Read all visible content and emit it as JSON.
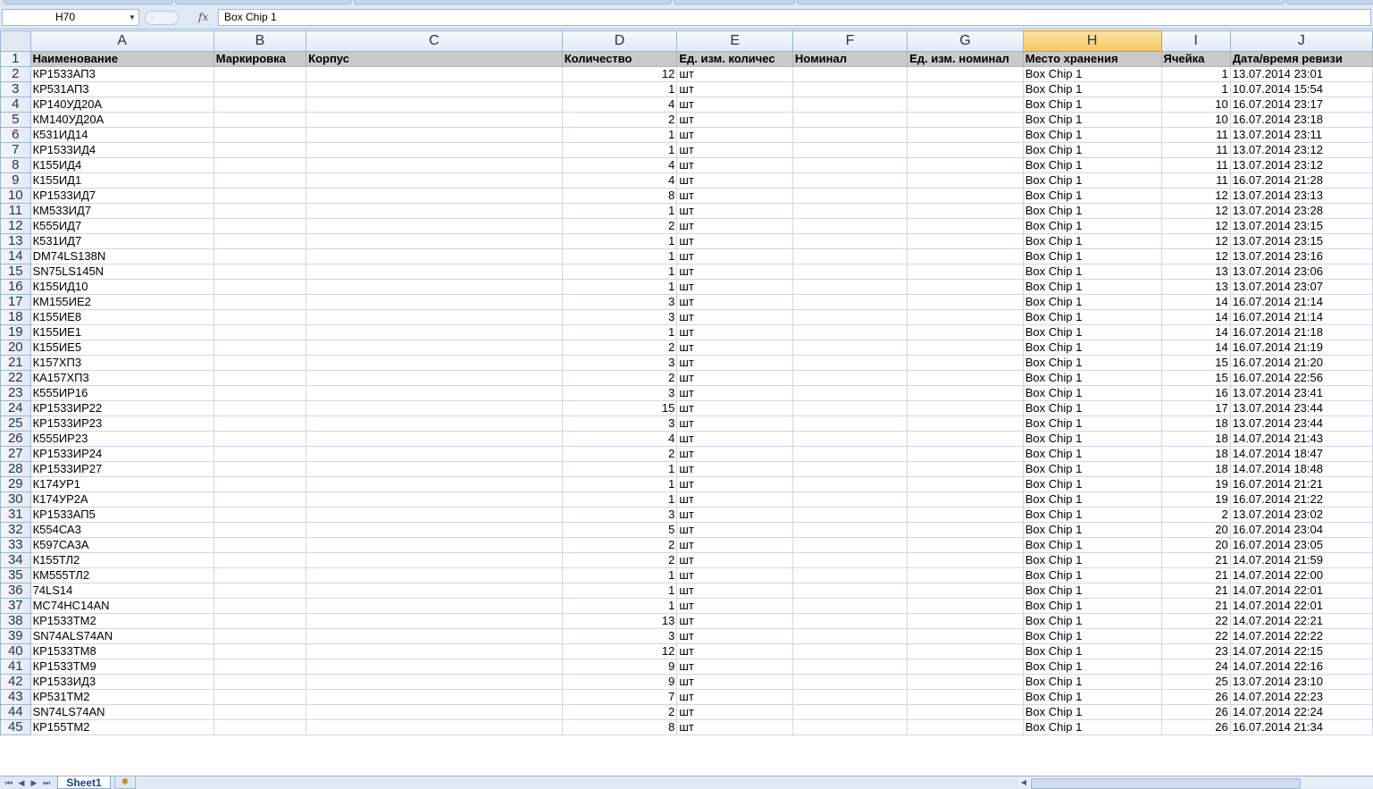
{
  "formula_bar": {
    "name_box": "H70",
    "function_icon": "fx-icon",
    "content": "Box Chip 1"
  },
  "grid": {
    "columns": [
      "A",
      "B",
      "C",
      "D",
      "E",
      "F",
      "G",
      "H",
      "I",
      "J"
    ],
    "selected_column": "H",
    "headers": [
      "Наименование",
      "Маркировка",
      "Корпус",
      "Количество",
      "Ед. изм. количес",
      "Номинал",
      "Ед. изм. номинал",
      "Место хранения",
      "Ячейка",
      "Дата/время ревизи"
    ],
    "rows": [
      [
        "КР1533АП3",
        "",
        "",
        "12",
        "шт",
        "",
        "",
        "Box Chip 1",
        "1",
        "13.07.2014 23:01"
      ],
      [
        "КР531АП3",
        "",
        "",
        "1",
        "шт",
        "",
        "",
        "Box Chip 1",
        "1",
        "10.07.2014 15:54"
      ],
      [
        "КР140УД20А",
        "",
        "",
        "4",
        "шт",
        "",
        "",
        "Box Chip 1",
        "10",
        "16.07.2014 23:17"
      ],
      [
        "КМ140УД20А",
        "",
        "",
        "2",
        "шт",
        "",
        "",
        "Box Chip 1",
        "10",
        "16.07.2014 23:18"
      ],
      [
        "К531ИД14",
        "",
        "",
        "1",
        "шт",
        "",
        "",
        "Box Chip 1",
        "11",
        "13.07.2014 23:11"
      ],
      [
        "КР1533ИД4",
        "",
        "",
        "1",
        "шт",
        "",
        "",
        "Box Chip 1",
        "11",
        "13.07.2014 23:12"
      ],
      [
        "К155ИД4",
        "",
        "",
        "4",
        "шт",
        "",
        "",
        "Box Chip 1",
        "11",
        "13.07.2014 23:12"
      ],
      [
        "К155ИД1",
        "",
        "",
        "4",
        "шт",
        "",
        "",
        "Box Chip 1",
        "11",
        "16.07.2014 21:28"
      ],
      [
        "КР1533ИД7",
        "",
        "",
        "8",
        "шт",
        "",
        "",
        "Box Chip 1",
        "12",
        "13.07.2014 23:13"
      ],
      [
        "КМ533ИД7",
        "",
        "",
        "1",
        "шт",
        "",
        "",
        "Box Chip 1",
        "12",
        "13.07.2014 23:28"
      ],
      [
        "К555ИД7",
        "",
        "",
        "2",
        "шт",
        "",
        "",
        "Box Chip 1",
        "12",
        "13.07.2014 23:15"
      ],
      [
        "К531ИД7",
        "",
        "",
        "1",
        "шт",
        "",
        "",
        "Box Chip 1",
        "12",
        "13.07.2014 23:15"
      ],
      [
        "DM74LS138N",
        "",
        "",
        "1",
        "шт",
        "",
        "",
        "Box Chip 1",
        "12",
        "13.07.2014 23:16"
      ],
      [
        "SN75LS145N",
        "",
        "",
        "1",
        "шт",
        "",
        "",
        "Box Chip 1",
        "13",
        "13.07.2014 23:06"
      ],
      [
        "К155ИД10",
        "",
        "",
        "1",
        "шт",
        "",
        "",
        "Box Chip 1",
        "13",
        "13.07.2014 23:07"
      ],
      [
        "КМ155ИЕ2",
        "",
        "",
        "3",
        "шт",
        "",
        "",
        "Box Chip 1",
        "14",
        "16.07.2014 21:14"
      ],
      [
        "К155ИЕ8",
        "",
        "",
        "3",
        "шт",
        "",
        "",
        "Box Chip 1",
        "14",
        "16.07.2014 21:14"
      ],
      [
        "К155ИЕ1",
        "",
        "",
        "1",
        "шт",
        "",
        "",
        "Box Chip 1",
        "14",
        "16.07.2014 21:18"
      ],
      [
        "К155ИЕ5",
        "",
        "",
        "2",
        "шт",
        "",
        "",
        "Box Chip 1",
        "14",
        "16.07.2014 21:19"
      ],
      [
        "К157ХП3",
        "",
        "",
        "3",
        "шт",
        "",
        "",
        "Box Chip 1",
        "15",
        "16.07.2014 21:20"
      ],
      [
        "КА157ХП3",
        "",
        "",
        "2",
        "шт",
        "",
        "",
        "Box Chip 1",
        "15",
        "16.07.2014 22:56"
      ],
      [
        "К555ИР16",
        "",
        "",
        "3",
        "шт",
        "",
        "",
        "Box Chip 1",
        "16",
        "13.07.2014 23:41"
      ],
      [
        "КР1533ИР22",
        "",
        "",
        "15",
        "шт",
        "",
        "",
        "Box Chip 1",
        "17",
        "13.07.2014 23:44"
      ],
      [
        "КР1533ИР23",
        "",
        "",
        "3",
        "шт",
        "",
        "",
        "Box Chip 1",
        "18",
        "13.07.2014 23:44"
      ],
      [
        "К555ИР23",
        "",
        "",
        "4",
        "шт",
        "",
        "",
        "Box Chip 1",
        "18",
        "14.07.2014 21:43"
      ],
      [
        "КР1533ИР24",
        "",
        "",
        "2",
        "шт",
        "",
        "",
        "Box Chip 1",
        "18",
        "14.07.2014 18:47"
      ],
      [
        "КР1533ИР27",
        "",
        "",
        "1",
        "шт",
        "",
        "",
        "Box Chip 1",
        "18",
        "14.07.2014 18:48"
      ],
      [
        "К174УР1",
        "",
        "",
        "1",
        "шт",
        "",
        "",
        "Box Chip 1",
        "19",
        "16.07.2014 21:21"
      ],
      [
        "К174УР2А",
        "",
        "",
        "1",
        "шт",
        "",
        "",
        "Box Chip 1",
        "19",
        "16.07.2014 21:22"
      ],
      [
        "КР1533АП5",
        "",
        "",
        "3",
        "шт",
        "",
        "",
        "Box Chip 1",
        "2",
        "13.07.2014 23:02"
      ],
      [
        "К554СА3",
        "",
        "",
        "5",
        "шт",
        "",
        "",
        "Box Chip 1",
        "20",
        "16.07.2014 23:04"
      ],
      [
        "К597СА3А",
        "",
        "",
        "2",
        "шт",
        "",
        "",
        "Box Chip 1",
        "20",
        "16.07.2014 23:05"
      ],
      [
        "К155ТЛ2",
        "",
        "",
        "2",
        "шт",
        "",
        "",
        "Box Chip 1",
        "21",
        "14.07.2014 21:59"
      ],
      [
        "КМ555ТЛ2",
        "",
        "",
        "1",
        "шт",
        "",
        "",
        "Box Chip 1",
        "21",
        "14.07.2014 22:00"
      ],
      [
        "74LS14",
        "",
        "",
        "1",
        "шт",
        "",
        "",
        "Box Chip 1",
        "21",
        "14.07.2014 22:01"
      ],
      [
        "MC74HC14AN",
        "",
        "",
        "1",
        "шт",
        "",
        "",
        "Box Chip 1",
        "21",
        "14.07.2014 22:01"
      ],
      [
        "КР1533ТМ2",
        "",
        "",
        "13",
        "шт",
        "",
        "",
        "Box Chip 1",
        "22",
        "14.07.2014 22:21"
      ],
      [
        "SN74ALS74AN",
        "",
        "",
        "3",
        "шт",
        "",
        "",
        "Box Chip 1",
        "22",
        "14.07.2014 22:22"
      ],
      [
        "КР1533ТМ8",
        "",
        "",
        "12",
        "шт",
        "",
        "",
        "Box Chip 1",
        "23",
        "14.07.2014 22:15"
      ],
      [
        "КР1533ТМ9",
        "",
        "",
        "9",
        "шт",
        "",
        "",
        "Box Chip 1",
        "24",
        "14.07.2014 22:16"
      ],
      [
        "КР1533ИД3",
        "",
        "",
        "9",
        "шт",
        "",
        "",
        "Box Chip 1",
        "25",
        "13.07.2014 23:10"
      ],
      [
        "КР531ТМ2",
        "",
        "",
        "7",
        "шт",
        "",
        "",
        "Box Chip 1",
        "26",
        "14.07.2014 22:23"
      ],
      [
        "SN74LS74AN",
        "",
        "",
        "2",
        "шт",
        "",
        "",
        "Box Chip 1",
        "26",
        "14.07.2014 22:24"
      ],
      [
        "КР155ТМ2",
        "",
        "",
        "8",
        "шт",
        "",
        "",
        "Box Chip 1",
        "26",
        "16.07.2014 21:34"
      ]
    ]
  },
  "sheet_tabs": {
    "active": "Sheet1",
    "insert_icon": "insert-sheet-icon"
  },
  "colors": {
    "header_fill": "#c9c9c9",
    "selected_column": "#f5c760",
    "grid_line": "#d0d7e5"
  }
}
